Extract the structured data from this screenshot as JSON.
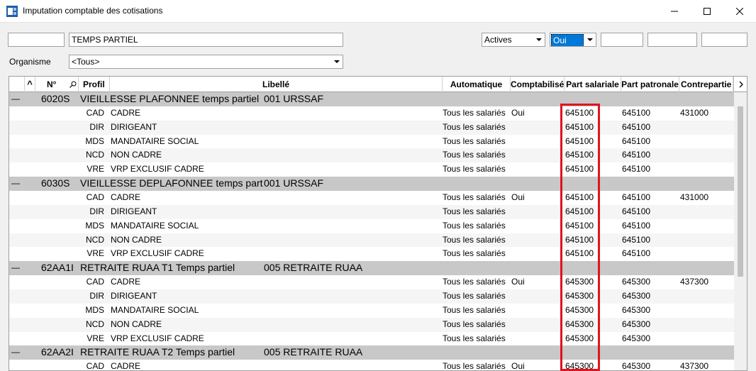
{
  "window": {
    "title": "Imputation comptable des cotisations"
  },
  "filters": {
    "code_value": "",
    "label_value": "TEMPS PARTIEL",
    "status_value": "Actives",
    "yesno_value": "Oui",
    "extra1_value": "",
    "extra2_value": "",
    "extra3_value": "",
    "organisme_label": "Organisme",
    "organisme_value": "<Tous>"
  },
  "columns": {
    "sort_arrow": "^",
    "num": "N°",
    "profil": "Profil",
    "libelle": "Libellé",
    "automatique": "Automatique",
    "comptabilise": "Comptabilisé",
    "part_salariale": "Part salariale",
    "part_patronale": "Part patronale",
    "contrepartie": "Contrepartie"
  },
  "groups": [
    {
      "code": "6020S",
      "label": "VIEILLESSE PLAFONNEE temps partiel",
      "organisme": "001 URSSAF",
      "rows": [
        {
          "profil": "CAD",
          "libelle": "CADRE",
          "auto": "Tous les salariés",
          "compta": "Oui",
          "sal": "645100",
          "pat": "645100",
          "contre": "431000"
        },
        {
          "profil": "DIR",
          "libelle": "DIRIGEANT",
          "auto": "Tous les salariés",
          "compta": "",
          "sal": "645100",
          "pat": "645100",
          "contre": ""
        },
        {
          "profil": "MDS",
          "libelle": "MANDATAIRE SOCIAL",
          "auto": "Tous les salariés",
          "compta": "",
          "sal": "645100",
          "pat": "645100",
          "contre": ""
        },
        {
          "profil": "NCD",
          "libelle": "NON CADRE",
          "auto": "Tous les salariés",
          "compta": "",
          "sal": "645100",
          "pat": "645100",
          "contre": ""
        },
        {
          "profil": "VRE",
          "libelle": "VRP EXCLUSIF CADRE",
          "auto": "Tous les salariés",
          "compta": "",
          "sal": "645100",
          "pat": "645100",
          "contre": ""
        }
      ]
    },
    {
      "code": "6030S",
      "label": "VIEILLESSE DEPLAFONNEE temps parti",
      "organisme": "001 URSSAF",
      "rows": [
        {
          "profil": "CAD",
          "libelle": "CADRE",
          "auto": "Tous les salariés",
          "compta": "Oui",
          "sal": "645100",
          "pat": "645100",
          "contre": "431000"
        },
        {
          "profil": "DIR",
          "libelle": "DIRIGEANT",
          "auto": "Tous les salariés",
          "compta": "",
          "sal": "645100",
          "pat": "645100",
          "contre": ""
        },
        {
          "profil": "MDS",
          "libelle": "MANDATAIRE SOCIAL",
          "auto": "Tous les salariés",
          "compta": "",
          "sal": "645100",
          "pat": "645100",
          "contre": ""
        },
        {
          "profil": "NCD",
          "libelle": "NON CADRE",
          "auto": "Tous les salariés",
          "compta": "",
          "sal": "645100",
          "pat": "645100",
          "contre": ""
        },
        {
          "profil": "VRE",
          "libelle": "VRP EXCLUSIF CADRE",
          "auto": "Tous les salariés",
          "compta": "",
          "sal": "645100",
          "pat": "645100",
          "contre": ""
        }
      ]
    },
    {
      "code": "62AA1I",
      "label": "RETRAITE RUAA T1 Temps partiel",
      "organisme": "005 RETRAITE RUAA",
      "rows": [
        {
          "profil": "CAD",
          "libelle": "CADRE",
          "auto": "Tous les salariés",
          "compta": "Oui",
          "sal": "645300",
          "pat": "645300",
          "contre": "437300"
        },
        {
          "profil": "DIR",
          "libelle": "DIRIGEANT",
          "auto": "Tous les salariés",
          "compta": "",
          "sal": "645300",
          "pat": "645300",
          "contre": ""
        },
        {
          "profil": "MDS",
          "libelle": "MANDATAIRE SOCIAL",
          "auto": "Tous les salariés",
          "compta": "",
          "sal": "645300",
          "pat": "645300",
          "contre": ""
        },
        {
          "profil": "NCD",
          "libelle": "NON CADRE",
          "auto": "Tous les salariés",
          "compta": "",
          "sal": "645300",
          "pat": "645300",
          "contre": ""
        },
        {
          "profil": "VRE",
          "libelle": "VRP EXCLUSIF CADRE",
          "auto": "Tous les salariés",
          "compta": "",
          "sal": "645300",
          "pat": "645300",
          "contre": ""
        }
      ]
    },
    {
      "code": "62AA2I",
      "label": "RETRAITE RUAA T2 Temps partiel",
      "organisme": "005 RETRAITE RUAA",
      "rows": [
        {
          "profil": "CAD",
          "libelle": "CADRE",
          "auto": "Tous les salariés",
          "compta": "Oui",
          "sal": "645300",
          "pat": "645300",
          "contre": "437300"
        }
      ]
    }
  ]
}
